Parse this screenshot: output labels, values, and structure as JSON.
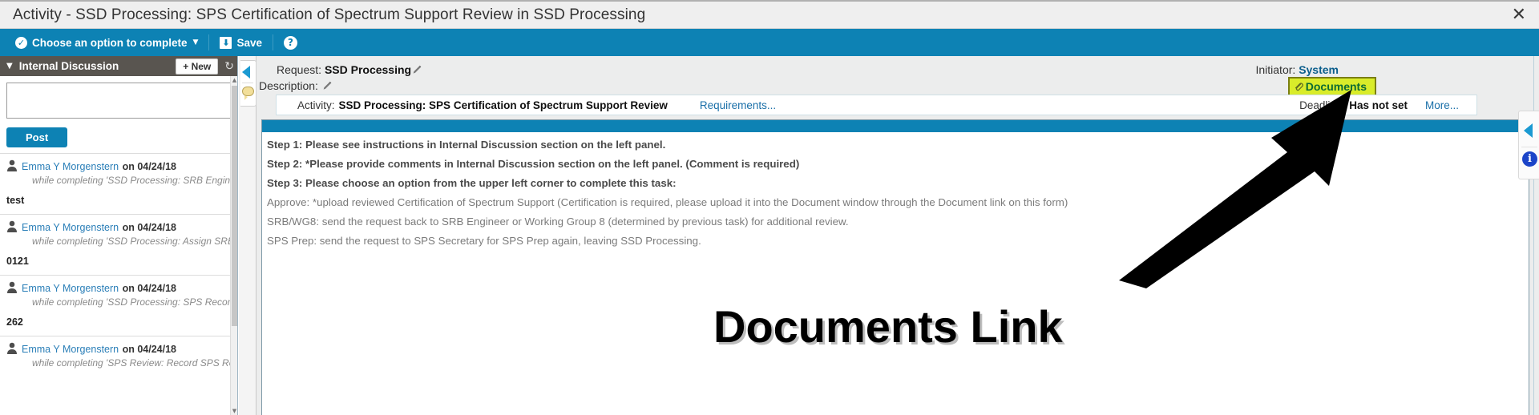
{
  "window": {
    "title": "Activity - SSD Processing: SPS Certification of Spectrum Support Review in SSD Processing",
    "close_icon": "close-icon"
  },
  "toolbar": {
    "complete_label": "Choose an option to complete",
    "complete_icon": "check-circle-icon",
    "caret_icon": "caret-down-icon",
    "save_label": "Save",
    "save_icon": "save-disk-icon",
    "help_icon": "help-question-icon"
  },
  "sidebar": {
    "title": "Internal Discussion",
    "collapse_icon": "chevron-down-icon",
    "new_label": "+ New",
    "refresh_icon": "refresh-icon",
    "compose_value": "",
    "compose_placeholder": "",
    "post_label": "Post",
    "comments": [
      {
        "author": "Emma Y Morgenstern",
        "date": "on 04/24/18",
        "context": "while completing 'SSD Processing: SRB Engineer Review'",
        "body": "test"
      },
      {
        "author": "Emma Y Morgenstern",
        "date": "on 04/24/18",
        "context": "while completing 'SSD Processing: Assign SRB Engineer'",
        "body": "0121"
      },
      {
        "author": "Emma Y Morgenstern",
        "date": "on 04/24/18",
        "context": "while completing 'SSD Processing: SPS Recommendation'",
        "body": "262"
      },
      {
        "author": "Emma Y Morgenstern",
        "date": "on 04/24/18",
        "context": "while completing 'SPS Review: Record SPS Results'",
        "body": ""
      }
    ]
  },
  "rail": {
    "collapse_icon": "triangle-left-icon",
    "comment_icon": "speech-bubble-icon"
  },
  "main": {
    "request_label": "Request:",
    "request_value": "SSD Processing",
    "request_edit_icon": "pencil-icon",
    "description_label": "Description:",
    "description_value": "",
    "description_edit_icon": "pencil-icon",
    "initiator_label": "Initiator:",
    "initiator_value": "System",
    "documents_label": "Documents",
    "documents_icon": "paperclip-icon",
    "activity_label": "Activity:",
    "activity_value": "SSD Processing: SPS Certification of Spectrum Support Review",
    "requirements_label": "Requirements...",
    "deadline_label": "Deadline:",
    "deadline_value": "Has not set",
    "more_label": "More...",
    "maximize_icon": "maximize-icon"
  },
  "instructions": {
    "steps": [
      "Step 1: Please see instructions in Internal Discussion section on the left panel.",
      "Step 2: *Please provide comments in Internal Discussion section on the left panel. (Comment is required)",
      "Step 3: Please choose an option from the upper left corner to complete this task:"
    ],
    "options": [
      "Approve: *upload reviewed Certification of Spectrum Support (Certification is required, please upload it into the Document window through the Document link on this form)",
      "SRB/WG8: send the request back to SRB Engineer or Working Group 8 (determined by previous task) for additional review.",
      "SPS Prep: send the request to SPS Secretary for SPS Prep again, leaving SSD Processing."
    ]
  },
  "right_rail": {
    "collapse_icon": "triangle-left-icon",
    "info_icon": "info-icon"
  },
  "annotation": {
    "text": "Documents Link",
    "arrow_icon": "arrow-up-right-icon",
    "highlight_color": "#d9ec2a"
  },
  "colors": {
    "toolbar_blue": "#0d82b4",
    "sidebar_header": "#595550",
    "link_blue": "#1a6fa8",
    "documents_green": "#0b6b33"
  }
}
